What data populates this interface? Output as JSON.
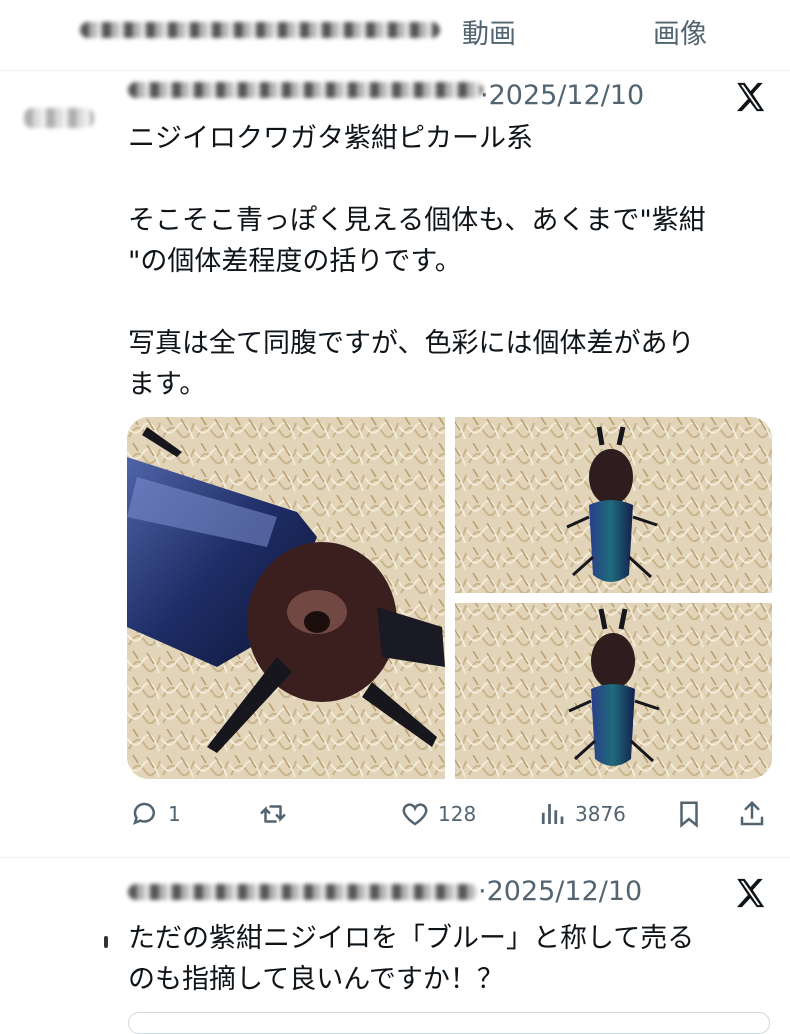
{
  "tabs": {
    "video": "動画",
    "image": "画像"
  },
  "tweets": [
    {
      "date": "·2025/12/10",
      "text": "ニジイロクワガタ紫紺ピカール系\n\nそこそこ青っぽく見える個体も、あくまで\"紫紺\n\"の個体差程度の括りです。\n\n写真は全て同腹ですが、色彩には個体差があり\nます。",
      "stats": {
        "replies": "1",
        "likes": "128",
        "views": "3876"
      }
    },
    {
      "date": "·2025/12/10",
      "text": "ただの紫紺ニジイロを「ブルー」と称して売る\nのも指摘して良いんですか！？"
    }
  ],
  "icons": [
    "x-logo-icon",
    "reply-icon",
    "repost-icon",
    "like-icon",
    "views-icon",
    "bookmark-icon",
    "share-icon"
  ],
  "colors": {
    "muted": "#536471",
    "text": "#0f1419",
    "border": "#eff3f4"
  }
}
